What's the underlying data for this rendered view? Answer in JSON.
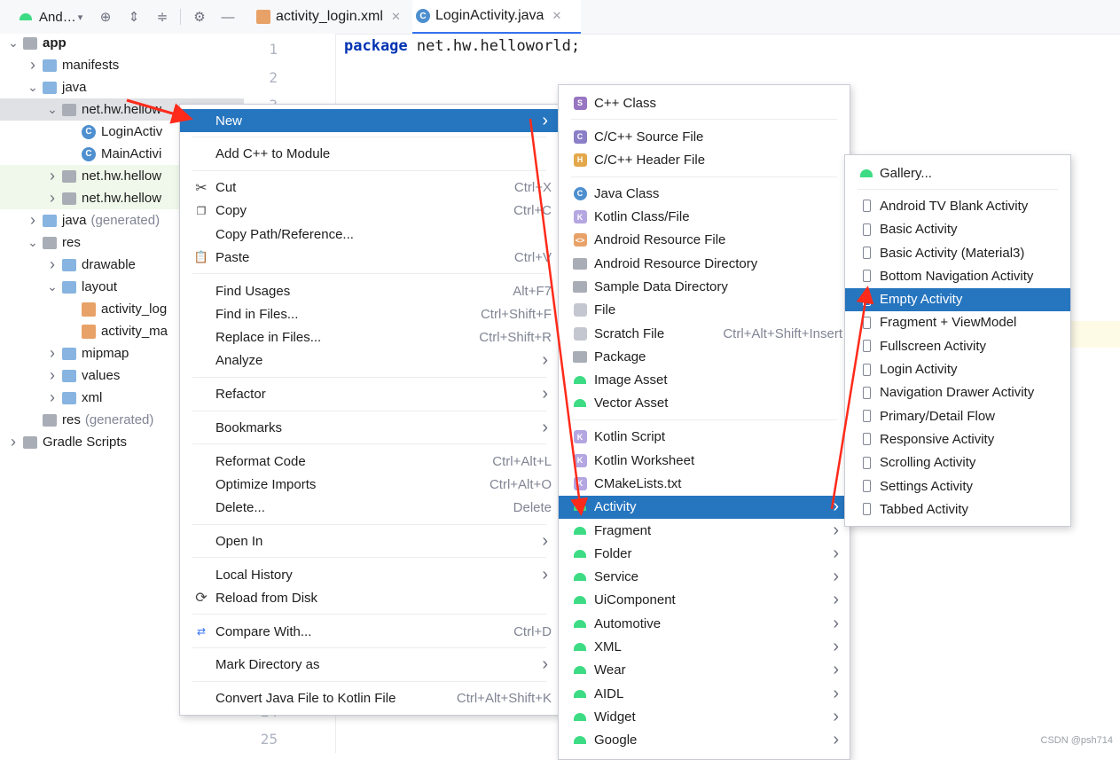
{
  "project_panel": {
    "view_selector": "And…",
    "tree": [
      {
        "label": "app",
        "indent": 0,
        "icon": "module-icon",
        "chevron": "down",
        "bold": true
      },
      {
        "label": "manifests",
        "indent": 1,
        "icon": "folder-icon",
        "chevron": "right"
      },
      {
        "label": "java",
        "indent": 1,
        "icon": "folder-icon",
        "chevron": "down"
      },
      {
        "label": "net.hw.hellow",
        "indent": 2,
        "icon": "package-icon",
        "chevron": "down",
        "state": "selected"
      },
      {
        "label": "LoginActiv",
        "indent": 3,
        "icon": "class-icon"
      },
      {
        "label": "MainActivi",
        "indent": 3,
        "icon": "class-icon"
      },
      {
        "label": "net.hw.hellow",
        "indent": 2,
        "icon": "package-icon",
        "chevron": "right",
        "state": "green"
      },
      {
        "label": "net.hw.hellow",
        "indent": 2,
        "icon": "package-icon",
        "chevron": "right",
        "state": "green"
      },
      {
        "label": "java",
        "suffix": "(generated)",
        "indent": 1,
        "icon": "generated-folder-icon",
        "chevron": "right"
      },
      {
        "label": "res",
        "indent": 1,
        "icon": "res-folder-icon",
        "chevron": "down"
      },
      {
        "label": "drawable",
        "indent": 2,
        "icon": "folder-icon",
        "chevron": "right"
      },
      {
        "label": "layout",
        "indent": 2,
        "icon": "folder-icon",
        "chevron": "down"
      },
      {
        "label": "activity_log",
        "indent": 3,
        "icon": "xml-file-icon"
      },
      {
        "label": "activity_ma",
        "indent": 3,
        "icon": "xml-file-icon"
      },
      {
        "label": "mipmap",
        "indent": 2,
        "icon": "folder-icon",
        "chevron": "right"
      },
      {
        "label": "values",
        "indent": 2,
        "icon": "folder-icon",
        "chevron": "right"
      },
      {
        "label": "xml",
        "indent": 2,
        "icon": "folder-icon",
        "chevron": "right"
      },
      {
        "label": "res",
        "suffix": "(generated)",
        "indent": 1,
        "icon": "res-folder-icon"
      },
      {
        "label": "Gradle Scripts",
        "indent": 0,
        "icon": "gradle-icon",
        "chevron": "right"
      }
    ]
  },
  "editor": {
    "tabs": [
      {
        "label": "activity_login.xml",
        "icon": "xml-file-icon",
        "active": false
      },
      {
        "label": "LoginActivity.java",
        "icon": "class-icon",
        "active": true
      }
    ],
    "line_numbers": [
      "1",
      "2",
      "3",
      "24",
      "25"
    ],
    "code": {
      "keyword": "package",
      "rest": "net.hw.helloworld;"
    }
  },
  "context_menu": {
    "items": [
      {
        "label": "New",
        "shortcut": "",
        "submenu": true,
        "highlighted": true
      },
      {
        "sep": true
      },
      {
        "label": "Add C++ to Module",
        "shortcut": ""
      },
      {
        "sep": true
      },
      {
        "label": "Cut",
        "shortcut": "Ctrl+X",
        "icon": "scissors-icon"
      },
      {
        "label": "Copy",
        "shortcut": "Ctrl+C",
        "icon": "copy-icon"
      },
      {
        "label": "Copy Path/Reference...",
        "shortcut": ""
      },
      {
        "label": "Paste",
        "shortcut": "Ctrl+V",
        "icon": "paste-icon"
      },
      {
        "sep": true
      },
      {
        "label": "Find Usages",
        "shortcut": "Alt+F7"
      },
      {
        "label": "Find in Files...",
        "shortcut": "Ctrl+Shift+F"
      },
      {
        "label": "Replace in Files...",
        "shortcut": "Ctrl+Shift+R"
      },
      {
        "label": "Analyze",
        "shortcut": "",
        "submenu": true
      },
      {
        "sep": true
      },
      {
        "label": "Refactor",
        "shortcut": "",
        "submenu": true
      },
      {
        "sep": true
      },
      {
        "label": "Bookmarks",
        "shortcut": "",
        "submenu": true
      },
      {
        "sep": true
      },
      {
        "label": "Reformat Code",
        "shortcut": "Ctrl+Alt+L"
      },
      {
        "label": "Optimize Imports",
        "shortcut": "Ctrl+Alt+O"
      },
      {
        "label": "Delete...",
        "shortcut": "Delete"
      },
      {
        "sep": true
      },
      {
        "label": "Open In",
        "shortcut": "",
        "submenu": true
      },
      {
        "sep": true
      },
      {
        "label": "Local History",
        "shortcut": "",
        "submenu": true
      },
      {
        "label": "Reload from Disk",
        "shortcut": "",
        "icon": "reload-icon"
      },
      {
        "sep": true
      },
      {
        "label": "Compare With...",
        "shortcut": "Ctrl+D",
        "icon": "compare-icon"
      },
      {
        "sep": true
      },
      {
        "label": "Mark Directory as",
        "shortcut": "",
        "submenu": true
      },
      {
        "sep": true
      },
      {
        "label": "Convert Java File to Kotlin File",
        "shortcut": "Ctrl+Alt+Shift+K"
      }
    ]
  },
  "new_submenu": {
    "items": [
      {
        "label": "C++ Class",
        "icon": "cpp-class-icon"
      },
      {
        "sep": true
      },
      {
        "label": "C/C++ Source File",
        "icon": "cpp-source-icon"
      },
      {
        "label": "C/C++ Header File",
        "icon": "cpp-header-icon"
      },
      {
        "sep": true
      },
      {
        "label": "Java Class",
        "icon": "java-class-icon"
      },
      {
        "label": "Kotlin Class/File",
        "icon": "kotlin-file-icon"
      },
      {
        "label": "Android Resource File",
        "icon": "resource-file-icon"
      },
      {
        "label": "Android Resource Directory",
        "icon": "folder-icon"
      },
      {
        "label": "Sample Data Directory",
        "icon": "folder-icon"
      },
      {
        "label": "File",
        "icon": "file-icon"
      },
      {
        "label": "Scratch File",
        "shortcut": "Ctrl+Alt+Shift+Insert",
        "icon": "scratch-file-icon"
      },
      {
        "label": "Package",
        "icon": "package-icon"
      },
      {
        "label": "Image Asset",
        "icon": "android-icon"
      },
      {
        "label": "Vector Asset",
        "icon": "android-icon"
      },
      {
        "sep": true
      },
      {
        "label": "Kotlin Script",
        "icon": "kotlin-script-icon"
      },
      {
        "label": "Kotlin Worksheet",
        "icon": "kotlin-worksheet-icon"
      },
      {
        "label": "CMakeLists.txt",
        "icon": "cmake-icon"
      },
      {
        "label": "Activity",
        "icon": "android-icon",
        "submenu": true,
        "highlighted": true
      },
      {
        "label": "Fragment",
        "icon": "android-icon",
        "submenu": true
      },
      {
        "label": "Folder",
        "icon": "android-icon",
        "submenu": true
      },
      {
        "label": "Service",
        "icon": "android-icon",
        "submenu": true
      },
      {
        "label": "UiComponent",
        "icon": "android-icon",
        "submenu": true
      },
      {
        "label": "Automotive",
        "icon": "android-icon",
        "submenu": true
      },
      {
        "label": "XML",
        "icon": "android-icon",
        "submenu": true
      },
      {
        "label": "Wear",
        "icon": "android-icon",
        "submenu": true
      },
      {
        "label": "AIDL",
        "icon": "android-icon",
        "submenu": true
      },
      {
        "label": "Widget",
        "icon": "android-icon",
        "submenu": true
      },
      {
        "label": "Google",
        "icon": "android-icon",
        "submenu": true
      }
    ]
  },
  "activity_submenu": {
    "items": [
      {
        "label": "Gallery...",
        "icon": "android-icon"
      },
      {
        "sep": true
      },
      {
        "label": "Android TV Blank Activity",
        "icon": "phone-icon"
      },
      {
        "label": "Basic Activity",
        "icon": "phone-icon"
      },
      {
        "label": "Basic Activity (Material3)",
        "icon": "phone-icon"
      },
      {
        "label": "Bottom Navigation Activity",
        "icon": "phone-icon"
      },
      {
        "label": "Empty Activity",
        "icon": "phone-icon",
        "highlighted": true
      },
      {
        "label": "Fragment + ViewModel",
        "icon": "phone-icon"
      },
      {
        "label": "Fullscreen Activity",
        "icon": "phone-icon"
      },
      {
        "label": "Login Activity",
        "icon": "phone-icon"
      },
      {
        "label": "Navigation Drawer Activity",
        "icon": "phone-icon"
      },
      {
        "label": "Primary/Detail Flow",
        "icon": "phone-icon"
      },
      {
        "label": "Responsive Activity",
        "icon": "phone-icon"
      },
      {
        "label": "Scrolling Activity",
        "icon": "phone-icon"
      },
      {
        "label": "Settings Activity",
        "icon": "phone-icon"
      },
      {
        "label": "Tabbed Activity",
        "icon": "phone-icon"
      }
    ]
  },
  "watermark": "CSDN @psh714",
  "colors": {
    "highlight": "#2675bf",
    "arrow": "#ff2a1a",
    "android_green": "#3ddc84"
  }
}
